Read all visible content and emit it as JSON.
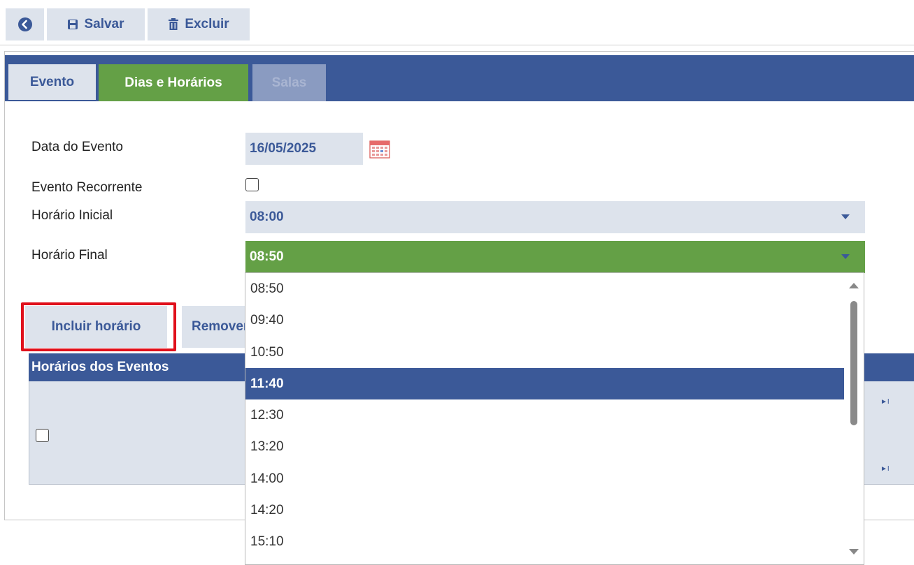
{
  "toolbar": {
    "back_icon": "arrow-left-circle-icon",
    "save_label": "Salvar",
    "save_icon": "floppy-disk-icon",
    "delete_label": "Excluir",
    "delete_icon": "trash-icon"
  },
  "tabs": [
    {
      "label": "Evento",
      "state": "inactive"
    },
    {
      "label": "Dias e Horários",
      "state": "active"
    },
    {
      "label": "Salas",
      "state": "disabled"
    }
  ],
  "form": {
    "data_label": "Data do Evento",
    "data_value": "16/05/2025",
    "calendar_icon": "calendar-icon",
    "recorrente_label": "Evento Recorrente",
    "recorrente_checked": false,
    "inicial_label": "Horário Inicial",
    "inicial_value": "08:00",
    "final_label": "Horário Final",
    "final_value": "08:50"
  },
  "actions": {
    "incluir_label": "Incluir horário",
    "remover_label": "Remover"
  },
  "grid": {
    "title": "Horários dos Eventos",
    "pager_symbol": "►I"
  },
  "dropdown": {
    "options": [
      "08:50",
      "09:40",
      "10:50",
      "11:40",
      "12:30",
      "13:20",
      "14:00",
      "14:20",
      "15:10"
    ],
    "highlighted": "11:40"
  },
  "colors": {
    "primary": "#3b5998",
    "active_tab": "#64a046",
    "field_bg": "#dde3ec",
    "highlight_border": "#e0101b"
  }
}
